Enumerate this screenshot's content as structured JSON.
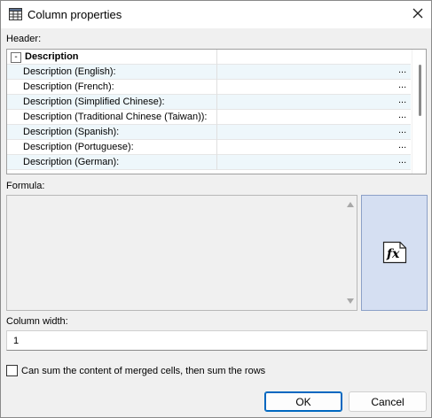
{
  "window": {
    "title": "Column properties"
  },
  "header_section": {
    "label": "Header:",
    "group": {
      "toggle": "-",
      "name": "Description"
    },
    "rows": [
      {
        "name": "Description (English):",
        "value": "",
        "ellipsis": "..."
      },
      {
        "name": "Description (French):",
        "value": "",
        "ellipsis": "..."
      },
      {
        "name": "Description (Simplified Chinese):",
        "value": "",
        "ellipsis": "..."
      },
      {
        "name": "Description (Traditional Chinese (Taiwan)):",
        "value": "",
        "ellipsis": "..."
      },
      {
        "name": "Description (Spanish):",
        "value": "",
        "ellipsis": "..."
      },
      {
        "name": "Description (Portuguese):",
        "value": "",
        "ellipsis": "..."
      },
      {
        "name": "Description (German):",
        "value": "",
        "ellipsis": "..."
      }
    ]
  },
  "formula_section": {
    "label": "Formula:",
    "value": "",
    "fx_button_icon": "function-fx-icon"
  },
  "column_width": {
    "label": "Column width:",
    "value": "1"
  },
  "merge_option": {
    "label": "Can sum the content of merged cells, then sum the rows",
    "checked": false
  },
  "buttons": {
    "ok": "OK",
    "cancel": "Cancel"
  },
  "colors": {
    "accent": "#0067c0",
    "fx_button_bg": "#d5dff2",
    "row_alt_bg": "#eef7fb"
  }
}
